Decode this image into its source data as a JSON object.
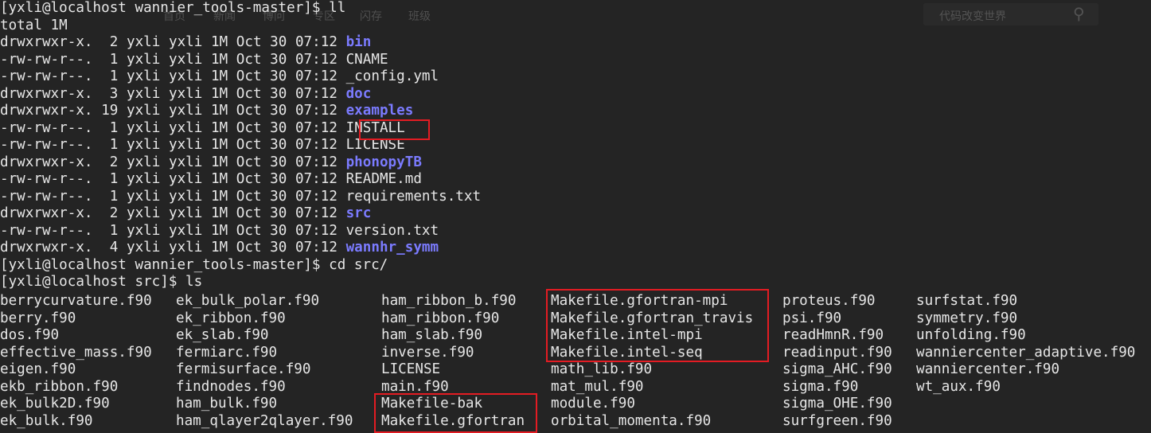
{
  "background_ghost": {
    "nav": [
      "首页",
      "新闻",
      "博问",
      "专区",
      "闪存",
      "班级"
    ],
    "search_placeholder": "代码改变世界"
  },
  "session": [
    {
      "kind": "prompt",
      "text": "[yxli@localhost wannier_tools-master]$ ll"
    },
    {
      "kind": "plain",
      "text": "total 1M"
    },
    {
      "kind": "ll",
      "perm": "drwxrwxr-x.",
      "links": " 2",
      "user": "yxli",
      "group": "yxli",
      "size": "1M",
      "date": "Oct 30 07:12",
      "name": "bin",
      "type": "dir"
    },
    {
      "kind": "ll",
      "perm": "-rw-rw-r--.",
      "links": " 1",
      "user": "yxli",
      "group": "yxli",
      "size": "1M",
      "date": "Oct 30 07:12",
      "name": "CNAME",
      "type": "file"
    },
    {
      "kind": "ll",
      "perm": "-rw-rw-r--.",
      "links": " 1",
      "user": "yxli",
      "group": "yxli",
      "size": "1M",
      "date": "Oct 30 07:12",
      "name": "_config.yml",
      "type": "file"
    },
    {
      "kind": "ll",
      "perm": "drwxrwxr-x.",
      "links": " 3",
      "user": "yxli",
      "group": "yxli",
      "size": "1M",
      "date": "Oct 30 07:12",
      "name": "doc",
      "type": "dir"
    },
    {
      "kind": "ll",
      "perm": "drwxrwxr-x.",
      "links": "19",
      "user": "yxli",
      "group": "yxli",
      "size": "1M",
      "date": "Oct 30 07:12",
      "name": "examples",
      "type": "dir"
    },
    {
      "kind": "ll",
      "perm": "-rw-rw-r--.",
      "links": " 1",
      "user": "yxli",
      "group": "yxli",
      "size": "1M",
      "date": "Oct 30 07:12",
      "name": "INSTALL",
      "type": "file"
    },
    {
      "kind": "ll",
      "perm": "-rw-rw-r--.",
      "links": " 1",
      "user": "yxli",
      "group": "yxli",
      "size": "1M",
      "date": "Oct 30 07:12",
      "name": "LICENSE",
      "type": "file"
    },
    {
      "kind": "ll",
      "perm": "drwxrwxr-x.",
      "links": " 2",
      "user": "yxli",
      "group": "yxli",
      "size": "1M",
      "date": "Oct 30 07:12",
      "name": "phonopyTB",
      "type": "dir"
    },
    {
      "kind": "ll",
      "perm": "-rw-rw-r--.",
      "links": " 1",
      "user": "yxli",
      "group": "yxli",
      "size": "1M",
      "date": "Oct 30 07:12",
      "name": "README.md",
      "type": "file"
    },
    {
      "kind": "ll",
      "perm": "-rw-rw-r--.",
      "links": " 1",
      "user": "yxli",
      "group": "yxli",
      "size": "1M",
      "date": "Oct 30 07:12",
      "name": "requirements.txt",
      "type": "file"
    },
    {
      "kind": "ll",
      "perm": "drwxrwxr-x.",
      "links": " 2",
      "user": "yxli",
      "group": "yxli",
      "size": "1M",
      "date": "Oct 30 07:12",
      "name": "src",
      "type": "dir"
    },
    {
      "kind": "ll",
      "perm": "-rw-rw-r--.",
      "links": " 1",
      "user": "yxli",
      "group": "yxli",
      "size": "1M",
      "date": "Oct 30 07:12",
      "name": "version.txt",
      "type": "file"
    },
    {
      "kind": "ll",
      "perm": "drwxrwxr-x.",
      "links": " 4",
      "user": "yxli",
      "group": "yxli",
      "size": "1M",
      "date": "Oct 30 07:12",
      "name": "wannhr_symm",
      "type": "dir"
    },
    {
      "kind": "prompt",
      "text": "[yxli@localhost wannier_tools-master]$ cd src/"
    },
    {
      "kind": "prompt",
      "text": "[yxli@localhost src]$ ls"
    }
  ],
  "ls_columns": [
    [
      "berrycurvature.f90",
      "berry.f90",
      "dos.f90",
      "effective_mass.f90",
      "eigen.f90",
      "ekb_ribbon.f90",
      "ek_bulk2D.f90",
      "ek_bulk.f90"
    ],
    [
      "ek_bulk_polar.f90",
      "ek_ribbon.f90",
      "ek_slab.f90",
      "fermiarc.f90",
      "fermisurface.f90",
      "findnodes.f90",
      "ham_bulk.f90",
      "ham_qlayer2qlayer.f90"
    ],
    [
      "ham_ribbon_b.f90",
      "ham_ribbon.f90",
      "ham_slab.f90",
      "inverse.f90",
      "LICENSE",
      "main.f90",
      "Makefile-bak",
      "Makefile.gfortran"
    ],
    [
      "Makefile.gfortran-mpi",
      "Makefile.gfortran_travis",
      "Makefile.intel-mpi",
      "Makefile.intel-seq",
      "math_lib.f90",
      "mat_mul.f90",
      "module.f90",
      "orbital_momenta.f90"
    ],
    [
      "proteus.f90",
      "psi.f90",
      "readHmnR.f90",
      "readinput.f90",
      "sigma_AHC.f90",
      "sigma.f90",
      "sigma_OHE.f90",
      "surfgreen.f90"
    ],
    [
      "surfstat.f90",
      "symmetry.f90",
      "unfolding.f90",
      "wanniercenter_adaptive.f90",
      "wanniercenter.f90",
      "wt_aux.f90"
    ]
  ],
  "colors": {
    "background": "#242424",
    "text": "#e6e6e6",
    "directory": "#7b7bff",
    "highlight_box": "#e31c23"
  }
}
